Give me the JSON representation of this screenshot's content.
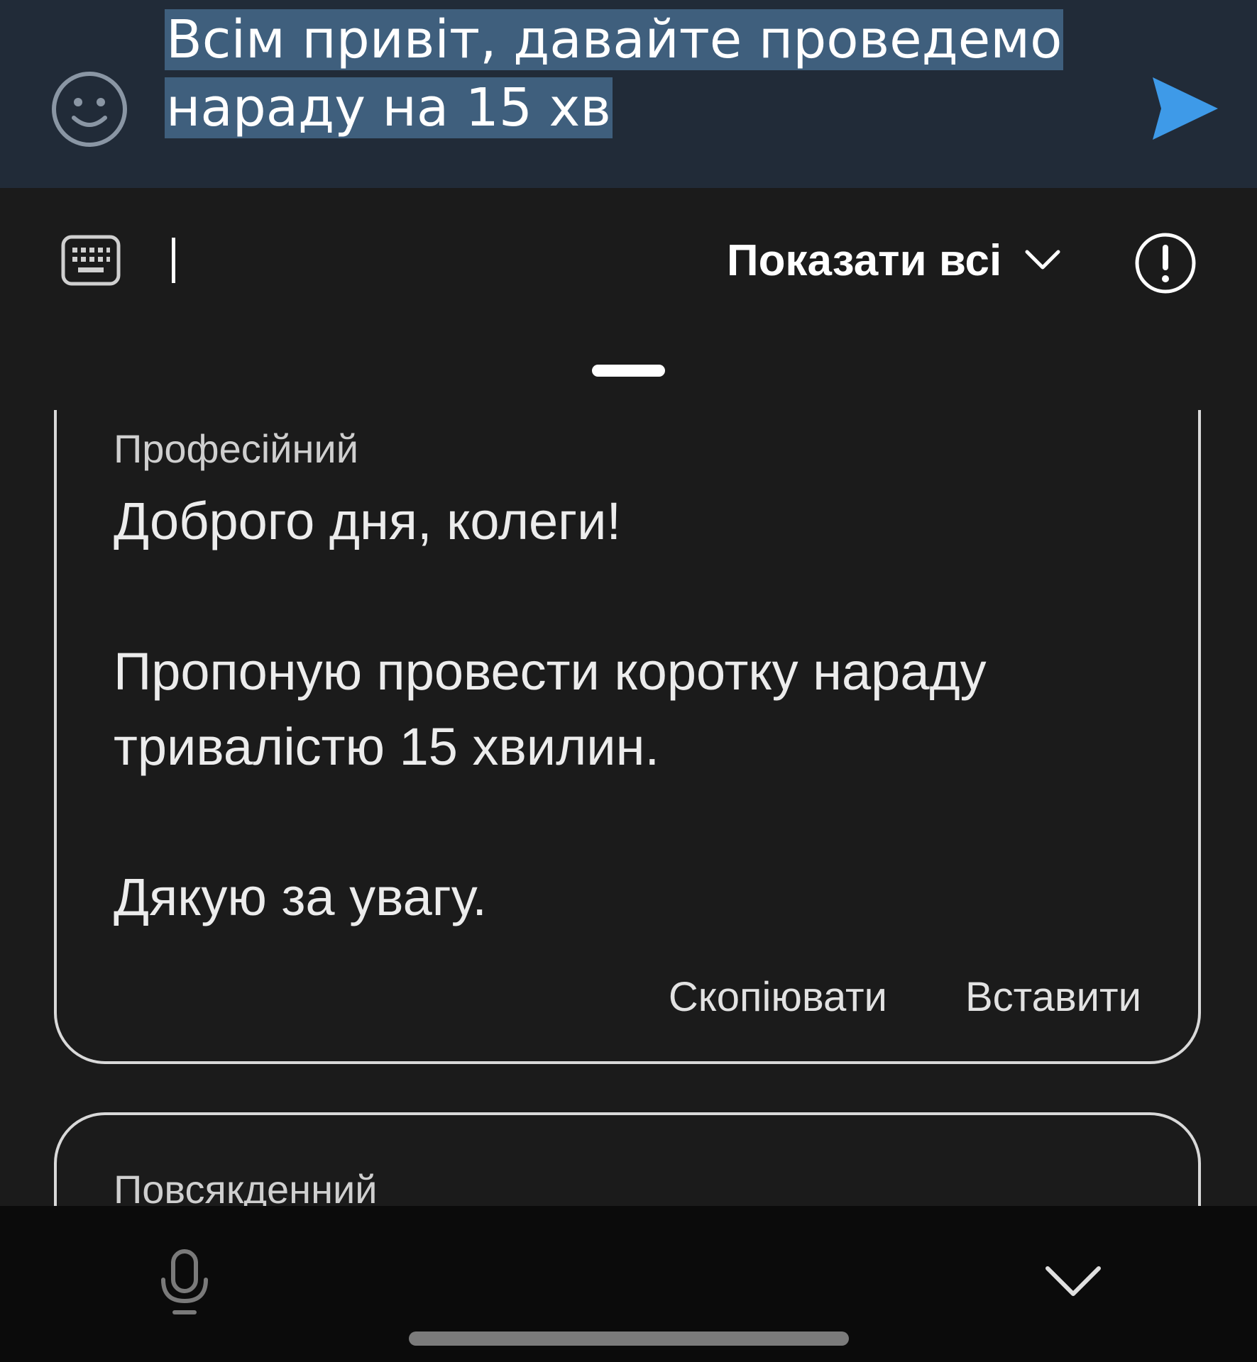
{
  "compose": {
    "line1": "Всім привіт, давайте проведемо",
    "line2": "нараду на 15 хв",
    "emoji_icon": "smiley-face-icon",
    "send_icon": "send-arrow-icon",
    "accent_color": "#3e9ae8",
    "selection_color": "#3f5f7d"
  },
  "toolbar": {
    "keyboard_icon": "keyboard-icon",
    "show_all_label": "Показати всі",
    "chevron_icon": "chevron-down-icon",
    "info_icon": "exclamation-circle-icon"
  },
  "suggestions": [
    {
      "tone": "Професійний",
      "lines": [
        "Доброго дня, колеги!",
        "Пропоную провести коротку нараду",
        "тривалістю 15 хвилин.",
        "Дякую за увагу."
      ],
      "copy_label": "Скопіювати",
      "insert_label": "Вставити"
    },
    {
      "tone": "Повсякденний"
    }
  ],
  "bottom": {
    "mic_icon": "microphone-icon",
    "collapse_icon": "chevron-down-icon"
  }
}
